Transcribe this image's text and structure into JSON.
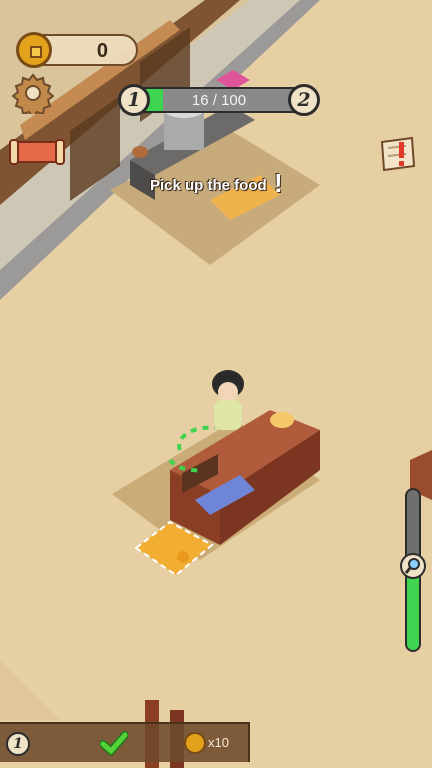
{
  "hud": {
    "coins": "0",
    "level_current": "1",
    "level_next": "2",
    "level_progress_text": "16 / 100",
    "level_progress_fraction": 0.16
  },
  "tooltip": {
    "text": "Pick up the food",
    "mark": "!"
  },
  "zoom": {
    "level_fraction": 0.6
  },
  "task_bar": {
    "badge": "1",
    "reward": "x10"
  },
  "icons": {
    "coin": "coin-icon",
    "settings": "gear-icon",
    "quests": "scroll-icon",
    "map_alert": "map-alert-icon",
    "zoom": "magnifier-icon",
    "done": "checkmark-icon"
  },
  "colors": {
    "progress_green": "#3fd44f",
    "coin_gold": "#e3a21b",
    "wood_dark": "#6f4b2b"
  }
}
